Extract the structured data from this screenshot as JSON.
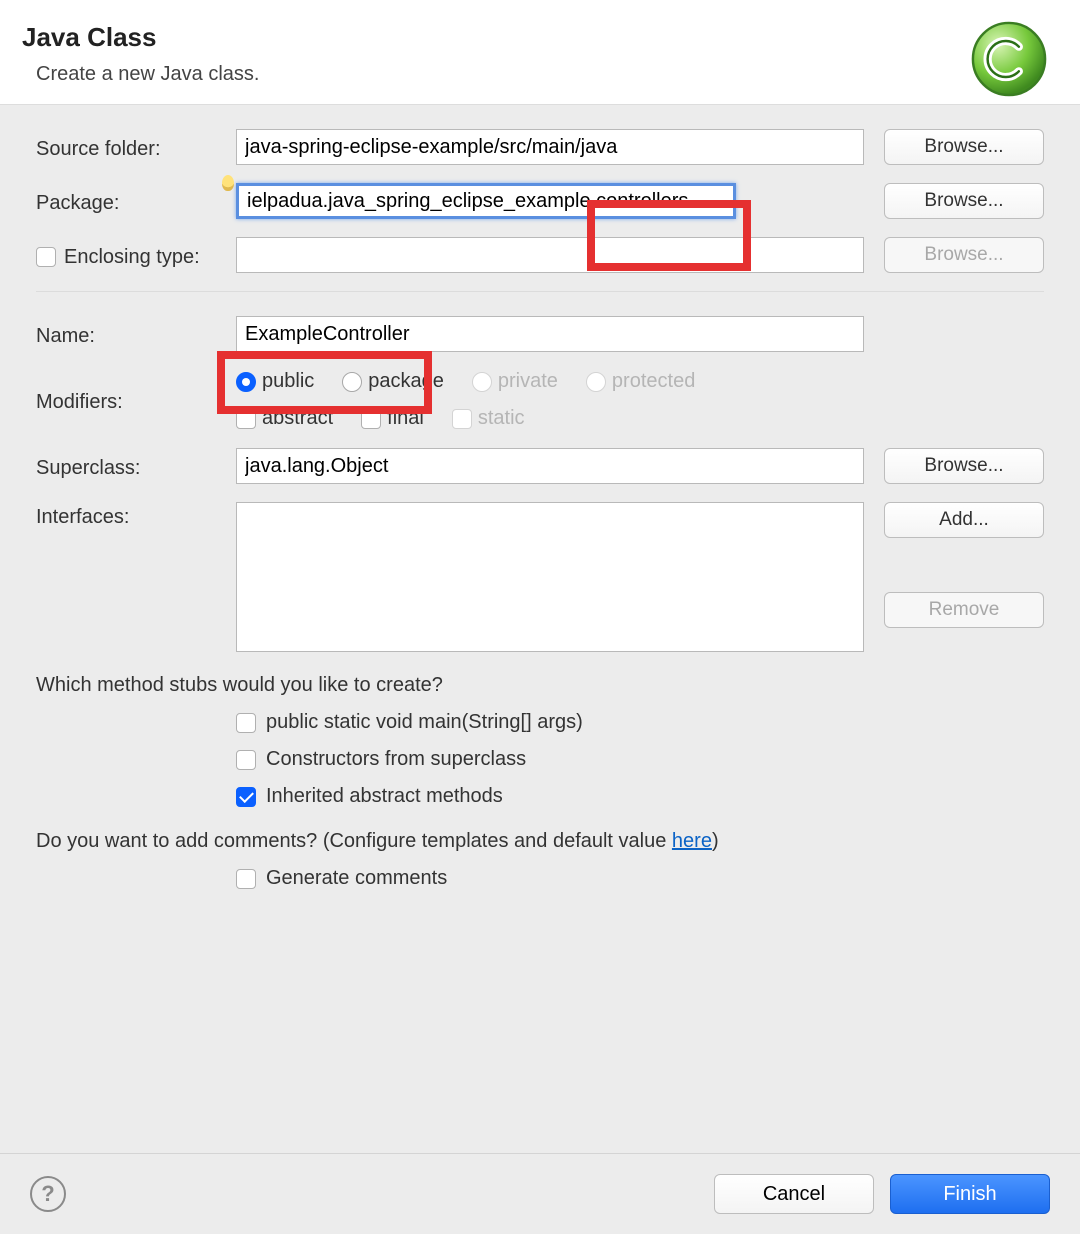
{
  "header": {
    "title": "Java Class",
    "subtitle": "Create a new Java class."
  },
  "fields": {
    "sourceFolder": {
      "label": "Source folder:",
      "value": "java-spring-eclipse-example/src/main/java",
      "browse": "Browse..."
    },
    "package": {
      "label": "Package:",
      "value": "ielpadua.java_spring_eclipse_example.controllers",
      "browse": "Browse..."
    },
    "enclosingType": {
      "label": "Enclosing type:",
      "value": "",
      "browse": "Browse..."
    },
    "name": {
      "label": "Name:",
      "value": "ExampleController"
    },
    "modifiers": {
      "label": "Modifiers:",
      "public": "public",
      "package": "package",
      "private": "private",
      "protected": "protected",
      "abstract": "abstract",
      "final": "final",
      "static": "static"
    },
    "superclass": {
      "label": "Superclass:",
      "value": "java.lang.Object",
      "browse": "Browse..."
    },
    "interfaces": {
      "label": "Interfaces:",
      "add": "Add...",
      "remove": "Remove"
    }
  },
  "stubs": {
    "question": "Which method stubs would you like to create?",
    "main": "public static void main(String[] args)",
    "constructors": "Constructors from superclass",
    "inherited": "Inherited abstract methods"
  },
  "comments": {
    "questionPrefix": "Do you want to add comments? (Configure templates and default value ",
    "linkText": "here",
    "questionSuffix": ")",
    "generate": "Generate comments"
  },
  "footer": {
    "cancel": "Cancel",
    "finish": "Finish"
  }
}
